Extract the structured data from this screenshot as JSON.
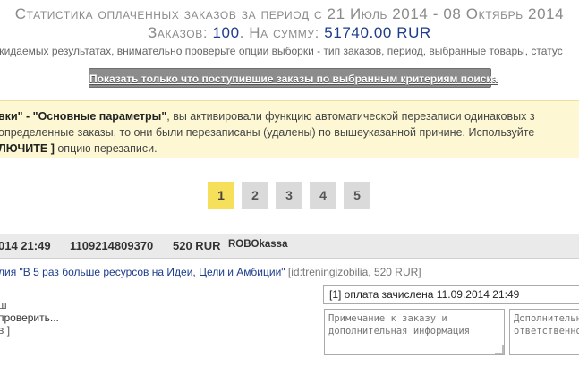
{
  "header": {
    "title": "Статистика оплаченных заказов за период с 21 Июль 2014 - 08 Октябрь 2014",
    "summary_prefix": "Заказов: ",
    "orders_count": "100",
    "summary_middle": ". На сумму: ",
    "orders_sum": "51740.00 RUR",
    "hint": "ожидаемых результатах, внимательно проверьте опции выборки - тип заказов, период, выбранные товары, статус"
  },
  "toolbar": {
    "show_new_label": "Показать только что поступившие заказы по выбранным критериям поиска"
  },
  "notice": {
    "line1_bold": "вки\" - \"Основные параметры\"",
    "line1_rest": ", вы активировали функцию автоматической перезаписи одинаковых з",
    "line2": "определенные заказы, то они были перезаписаны (удалены) по вышеуказанной причине. Используйте",
    "line3_bold": "ЛЮЧИТЕ ]",
    "line3_rest": " опцию перезаписи."
  },
  "pagination": {
    "pages": [
      "1",
      "2",
      "3",
      "4",
      "5"
    ],
    "active": "1"
  },
  "order": {
    "datetime": "014 21:49",
    "order_id": "1109214809370",
    "amount": "520 RUR",
    "gateway": "ROBOkassa",
    "product": "лия \"В 5 раз больше ресурсов на Идеи, Цели и Амбиции\"",
    "product_meta": "[id:treningizobilia, 520 RUR]",
    "payment_status": "[1] оплата зачислена 11.09.2014 21:49",
    "left_line1": "ш",
    "left_line2": "проверить...",
    "left_line3": "в ]",
    "note_placeholder": "Примечание к заказу и дополнительная информация",
    "extra_placeholder": "Дополнительны\nответственног"
  }
}
